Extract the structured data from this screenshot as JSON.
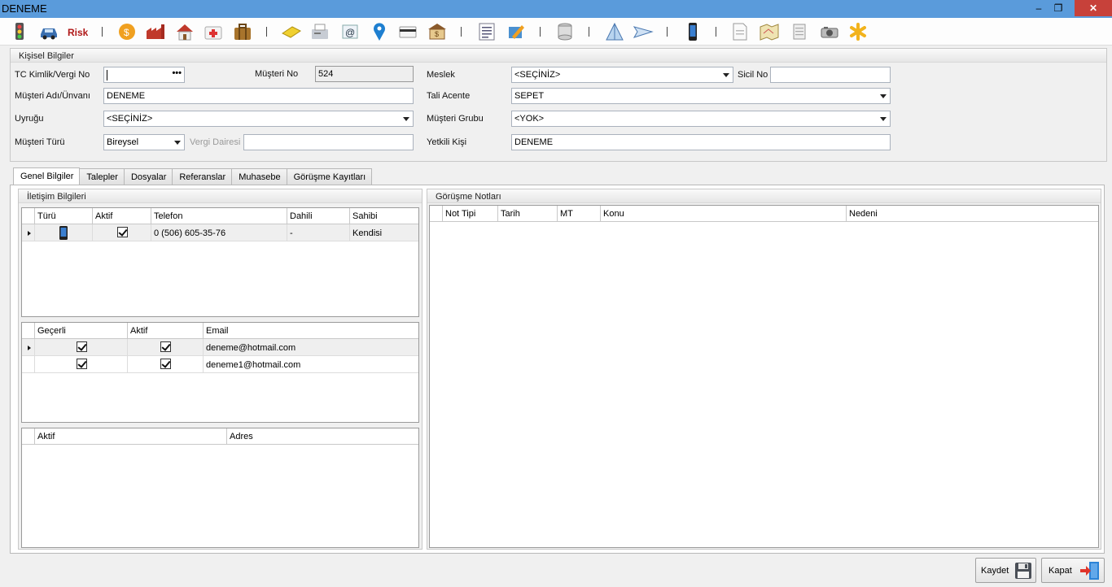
{
  "window": {
    "title": "DENEME",
    "controls": [
      "–",
      "❐",
      "✕"
    ]
  },
  "toolbar": {
    "icons": [
      "traffic-light-icon",
      "car-icon",
      "risk-icon",
      "coin-icon",
      "factory-icon",
      "house-icon",
      "first-aid-icon",
      "suitcase-icon",
      "soap-icon",
      "fax-icon",
      "email-icon",
      "location-pin-icon",
      "card-icon",
      "bank-icon",
      "list-icon",
      "tools-icon",
      "database-icon",
      "pyramid-icon",
      "paper-plane-icon",
      "mobile-phone-icon",
      "document-icon",
      "map-icon",
      "scroll-icon",
      "camera-icon",
      "asterisk-icon"
    ]
  },
  "personal": {
    "header": "Kişisel Bilgiler",
    "tc_label": "TC Kimlik/Vergi No",
    "tc_value": "",
    "tc_button": "•••",
    "musteri_no_label": "Müşteri No",
    "musteri_no_value": "524",
    "meslek_label": "Meslek",
    "meslek_value": "<SEÇİNİZ>",
    "sicil_label": "Sicil No",
    "sicil_value": "",
    "adi_label": "Müşteri Adı/Ünvanı",
    "adi_value": "DENEME",
    "tali_label": "Tali Acente",
    "tali_value": "SEPET",
    "uyrugu_label": "Uyruğu",
    "uyrugu_value": "<SEÇİNİZ>",
    "grubu_label": "Müşteri Grubu",
    "grubu_value": "<YOK>",
    "turu_label": "Müşteri Türü",
    "turu_value": "Bireysel",
    "vergi_label": "Vergi Dairesi",
    "vergi_value": "",
    "yetkili_label": "Yetkili Kişi",
    "yetkili_value": "DENEME"
  },
  "tabs": [
    "Genel Bilgiler",
    "Talepler",
    "Dosyalar",
    "Referanslar",
    "Muhasebe",
    "Görüşme Kayıtları"
  ],
  "contact": {
    "header": "İletişim Bilgileri",
    "phone_columns": [
      "Türü",
      "Aktif",
      "Telefon",
      "Dahili",
      "Sahibi"
    ],
    "phones": [
      {
        "turu": "mobile-phone-icon",
        "aktif": true,
        "telefon": "0 (506) 605-35-76",
        "dahili": "-",
        "sahibi": "Kendisi"
      }
    ],
    "email_columns": [
      "Geçerli",
      "Aktif",
      "Email"
    ],
    "emails": [
      {
        "gecerli": true,
        "aktif": true,
        "email": "deneme@hotmail.com"
      },
      {
        "gecerli": true,
        "aktif": true,
        "email": "deneme1@hotmail.com"
      }
    ],
    "address_columns": [
      "Aktif",
      "Adres"
    ]
  },
  "notes": {
    "header": "Görüşme Notları",
    "columns": [
      "Not Tipi",
      "Tarih",
      "MT",
      "Konu",
      "Nedeni"
    ]
  },
  "buttons": {
    "save": "Kaydet",
    "close": "Kapat"
  }
}
